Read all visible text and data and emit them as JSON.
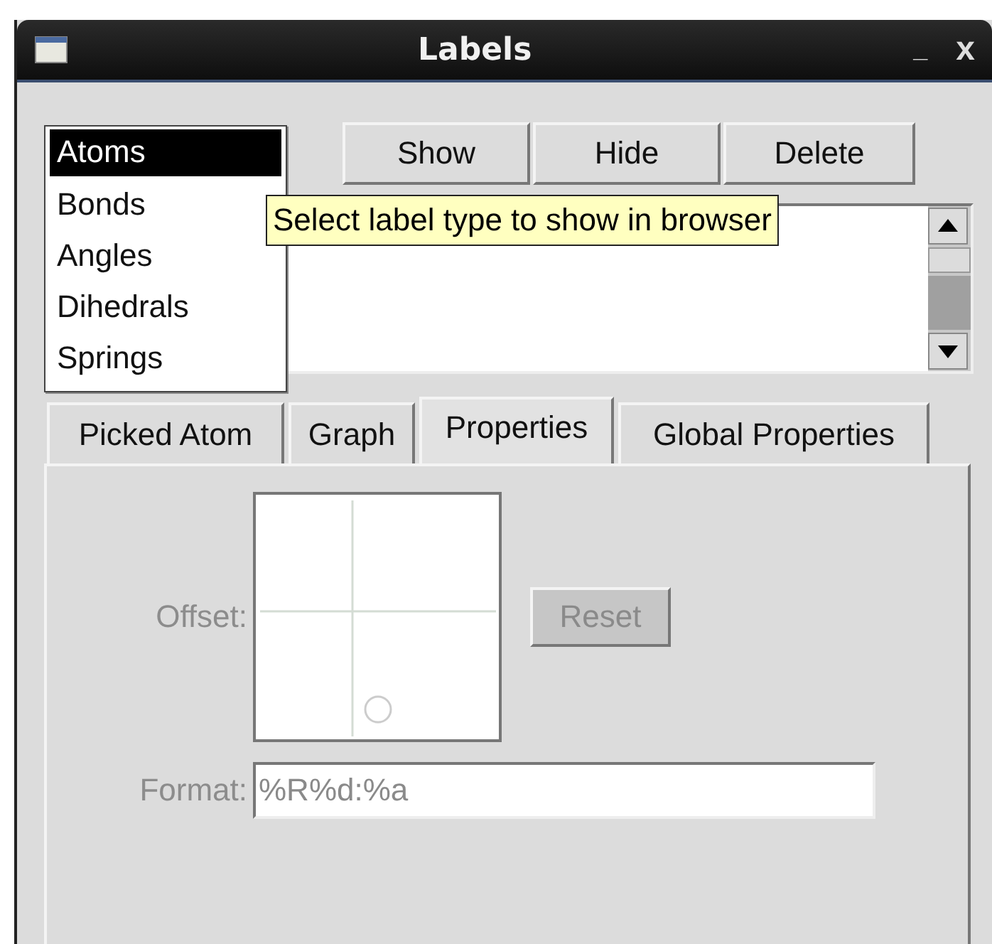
{
  "window": {
    "title": "Labels",
    "controls": [
      {
        "kind": "minimize",
        "label": "_"
      },
      {
        "kind": "close",
        "label": "x"
      }
    ]
  },
  "label_types": [
    {
      "label": "Atoms",
      "selected": true
    },
    {
      "label": "Bonds",
      "selected": false
    },
    {
      "label": "Angles",
      "selected": false
    },
    {
      "label": "Dihedrals",
      "selected": false
    },
    {
      "label": "Springs",
      "selected": false
    }
  ],
  "buttons": [
    "Show",
    "Hide",
    "Delete"
  ],
  "tooltip": "Select label type to show in browser",
  "tabs": [
    {
      "label": "Picked Atom",
      "selected": false
    },
    {
      "label": "Graph",
      "selected": false
    },
    {
      "label": "Properties",
      "selected": true
    },
    {
      "label": "Global Properties",
      "selected": false
    }
  ],
  "properties": {
    "disabled": true,
    "offset_label": "Offset:",
    "reset_button": "Reset",
    "format_label": "Format:",
    "format_value": "%R%d:%a"
  }
}
